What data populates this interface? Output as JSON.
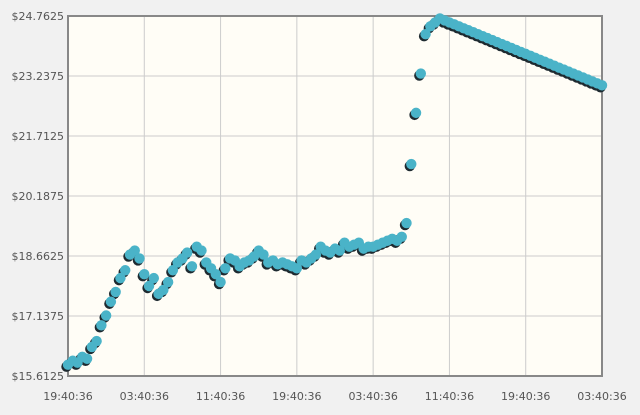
{
  "chart_data": {
    "type": "scatter",
    "title": "",
    "xlabel": "",
    "ylabel": "",
    "x_tick_labels": [
      "19:40:36",
      "03:40:36",
      "11:40:36",
      "19:40:36",
      "03:40:36",
      "11:40:36",
      "19:40:36",
      "03:40:36"
    ],
    "y_tick_labels": [
      "$15.6125",
      "$17.1375",
      "$18.6625",
      "$20.1875",
      "$21.7125",
      "$23.2375",
      "$24.7625"
    ],
    "xlim_hours": [
      0,
      56
    ],
    "ylim": [
      15.6125,
      24.7625
    ],
    "grid": true,
    "legend": "none",
    "colors": {
      "marker": "#4ab3c8",
      "marker_shadow": "#1e2a30",
      "plot_background": "#fffdf6",
      "page_background": "#f1f1f1",
      "grid": "#cccccc",
      "axis": "#888888"
    },
    "series": [
      {
        "x_hours": [
          0,
          0.5,
          1,
          1.5,
          2,
          2.5,
          3,
          3.5,
          4,
          4.5,
          5,
          5.5,
          6,
          6.5,
          7,
          7.5,
          8,
          8.5,
          9,
          9.5,
          10,
          10.5,
          11,
          11.5,
          12,
          12.5,
          13,
          13.5,
          14,
          14.5,
          15,
          15.5,
          16,
          16.5,
          17,
          17.5,
          18,
          18.5,
          19,
          19.5,
          20,
          20.5,
          21,
          21.5,
          22,
          22.5,
          23,
          23.5,
          24,
          24.5,
          25,
          25.5,
          26,
          26.5,
          27,
          27.5,
          28,
          28.5,
          29,
          29.5,
          30,
          30.5,
          31,
          31.5,
          32,
          32.5,
          33,
          33.5,
          34,
          34.5,
          35,
          35.5,
          36,
          36.5,
          37,
          37.5,
          38,
          38.5,
          39,
          39.5,
          40,
          40.5,
          41,
          41.5,
          42,
          42.5,
          43,
          43.5,
          44,
          44.5,
          45,
          45.5,
          46,
          46.5,
          47,
          47.5,
          48,
          48.5,
          49,
          49.5,
          50,
          50.5,
          51,
          51.5,
          52,
          52.5,
          53,
          53.5,
          54,
          54.5,
          55,
          55.5,
          56
        ],
        "values": [
          15.9,
          16.0,
          15.95,
          16.1,
          16.05,
          16.35,
          16.5,
          16.9,
          17.15,
          17.5,
          17.75,
          18.1,
          18.3,
          18.7,
          18.8,
          18.6,
          18.2,
          17.9,
          18.1,
          17.7,
          17.8,
          18.0,
          18.3,
          18.5,
          18.6,
          18.75,
          18.4,
          18.9,
          18.8,
          18.5,
          18.35,
          18.2,
          18.0,
          18.35,
          18.6,
          18.55,
          18.4,
          18.5,
          18.55,
          18.65,
          18.8,
          18.7,
          18.5,
          18.55,
          18.45,
          18.5,
          18.45,
          18.4,
          18.35,
          18.55,
          18.5,
          18.6,
          18.7,
          18.9,
          18.8,
          18.75,
          18.85,
          18.8,
          19.0,
          18.9,
          18.95,
          19.0,
          18.85,
          18.9,
          18.9,
          18.95,
          19.0,
          19.05,
          19.1,
          19.05,
          19.15,
          19.5,
          21.0,
          22.3,
          23.3,
          24.3,
          24.5,
          24.6,
          24.7,
          24.65,
          24.6,
          24.55,
          24.5,
          24.45,
          24.4,
          24.35,
          24.3,
          24.25,
          24.2,
          24.15,
          24.1,
          24.05,
          24.0,
          23.95,
          23.9,
          23.85,
          23.8,
          23.75,
          23.7,
          23.65,
          23.6,
          23.55,
          23.5,
          23.45,
          23.4,
          23.35,
          23.3,
          23.25,
          23.2,
          23.15,
          23.1,
          23.05,
          23.0
        ]
      }
    ]
  }
}
